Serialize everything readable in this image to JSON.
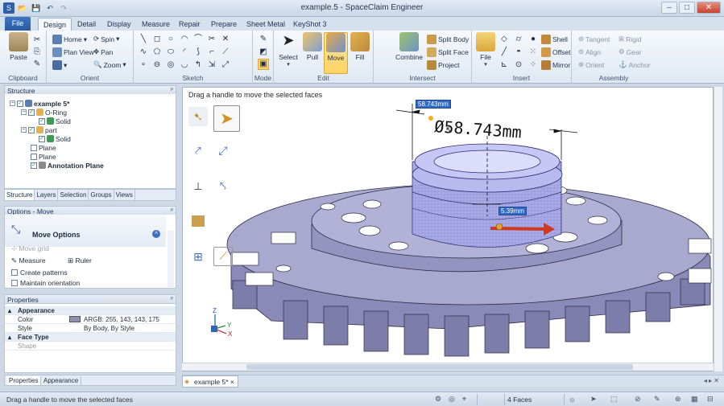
{
  "window": {
    "title": "example.5 - SpaceClaim Engineer"
  },
  "ribbon_tabs": [
    "File",
    "Design",
    "Detail",
    "Display",
    "Measure",
    "Repair",
    "Prepare",
    "Sheet Metal",
    "KeyShot 3"
  ],
  "ribbon": {
    "clipboard": {
      "label": "Clipboard",
      "paste": "Paste"
    },
    "orient": {
      "label": "Orient",
      "home": "Home",
      "plan_view": "Plan View",
      "spin": "Spin",
      "pan": "Pan",
      "zoom": "Zoom"
    },
    "sketch": {
      "label": "Sketch"
    },
    "mode": {
      "label": "Mode"
    },
    "edit": {
      "label": "Edit",
      "select": "Select",
      "pull": "Pull",
      "move": "Move",
      "fill": "Fill"
    },
    "intersect": {
      "label": "Intersect",
      "combine": "Combine",
      "split_body": "Split Body",
      "split_face": "Split Face",
      "project": "Project"
    },
    "insert": {
      "label": "Insert",
      "file": "File",
      "shell": "Shell",
      "offset": "Offset",
      "mirror": "Mirror"
    },
    "assembly": {
      "label": "Assembly",
      "tangent": "Tangent",
      "align": "Align",
      "orient": "Orient",
      "rigid": "Rigid",
      "gear": "Gear",
      "anchor": "Anchor"
    }
  },
  "structure": {
    "title": "Structure",
    "items": [
      "example 5*",
      "O-Ring",
      "Solid",
      "part",
      "Solid",
      "Plane",
      "Plane",
      "Annotation Plane"
    ],
    "tabs": [
      "Structure",
      "Layers",
      "Selection",
      "Groups",
      "Views"
    ]
  },
  "options": {
    "title": "Options - Move",
    "header": "Move Options",
    "move_grid": "Move grid",
    "measure": "Measure",
    "ruler": "Ruler",
    "create_patterns": "Create patterns",
    "maintain_orientation": "Maintain orientation"
  },
  "properties": {
    "title": "Properties",
    "appearance": "Appearance",
    "color_key": "Color",
    "color_value": "ARGB: 255, 143, 143, 175",
    "swatch": "#8f8faf",
    "style_key": "Style",
    "style_value": "By Body, By Style",
    "face_type": "Face Type",
    "shape_key": "Shape",
    "tabs": [
      "Properties",
      "Appearance"
    ]
  },
  "viewport": {
    "hint": "Drag a handle to move the selected faces",
    "dim_box": "58.743mm",
    "dim_large": "Ø58.743mm",
    "dim_small": "5.39mm",
    "part_color": "#9b9bc4",
    "axes": [
      "Z",
      "Y",
      "X"
    ]
  },
  "doc_tab": "example 5*",
  "status": {
    "message": "Drag a handle to move the selected faces",
    "faces": "4 Faces"
  }
}
